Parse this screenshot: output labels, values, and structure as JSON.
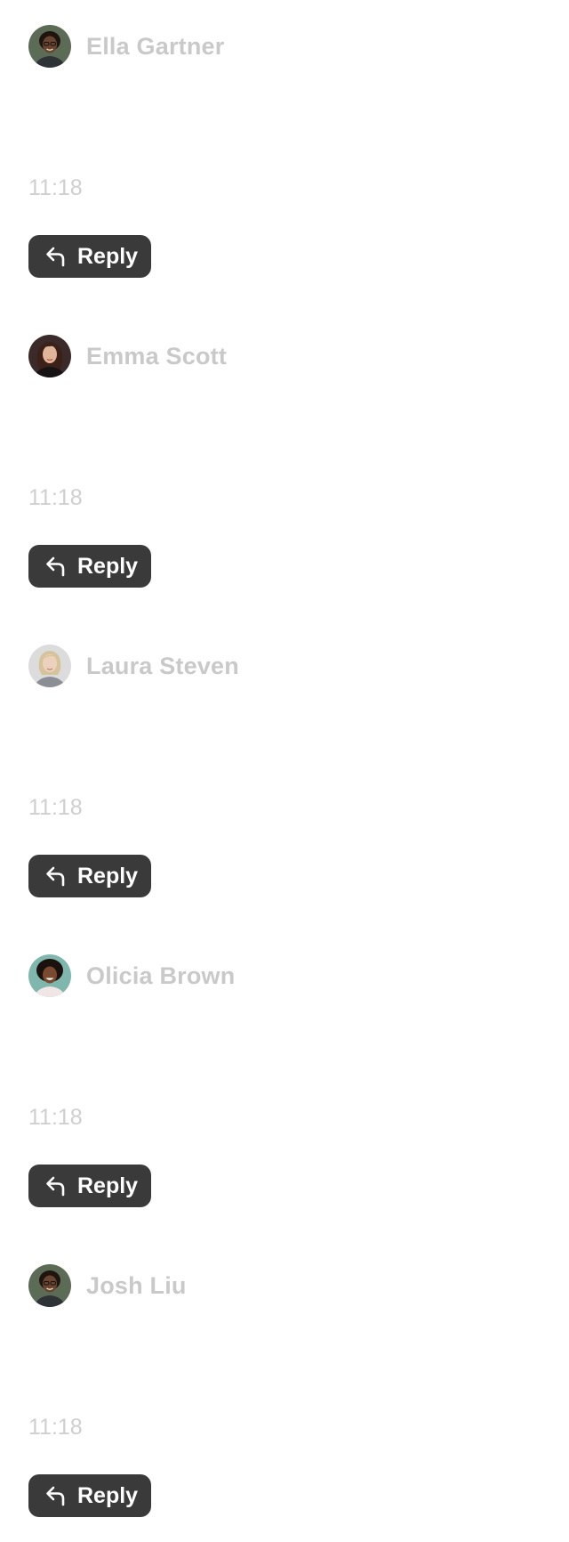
{
  "messages": [
    {
      "author": "Ella Gartner",
      "time": "11:18",
      "reply_label": "Reply",
      "avatar": {
        "icon": "avatar-ella-gartner",
        "bg": "#5b6b55",
        "skin": "#6b4530",
        "hair": "#1e1410",
        "shirt": "#2e3338"
      }
    },
    {
      "author": "Emma Scott",
      "time": "11:18",
      "reply_label": "Reply",
      "avatar": {
        "icon": "avatar-emma-scott",
        "bg": "#3a2a2a",
        "skin": "#e0b59a",
        "hair": "#3b2117",
        "shirt": "#161314"
      }
    },
    {
      "author": "Laura Steven",
      "time": "11:18",
      "reply_label": "Reply",
      "avatar": {
        "icon": "avatar-laura-steven",
        "bg": "#dcdcdc",
        "skin": "#ecd2bd",
        "hair": "#d6c39a",
        "shirt": "#8b8f95"
      }
    },
    {
      "author": "Olicia Brown",
      "time": "11:18",
      "reply_label": "Reply",
      "avatar": {
        "icon": "avatar-olicia-brown",
        "bg": "#7fb6ad",
        "skin": "#7a4a30",
        "hair": "#1b120d",
        "shirt": "#f0e6e6"
      }
    },
    {
      "author": "Josh Liu",
      "time": "11:18",
      "reply_label": "Reply",
      "avatar": {
        "icon": "avatar-josh-liu",
        "bg": "#5b6b55",
        "skin": "#6b4530",
        "hair": "#1e1410",
        "shirt": "#2e3338"
      }
    }
  ],
  "colors": {
    "author_text": "#c9c9c9",
    "time_text": "#cfcfcf",
    "reply_bg": "#3a3a3a",
    "reply_text": "#ffffff"
  },
  "icons": {
    "reply": "reply-arrow-icon"
  }
}
